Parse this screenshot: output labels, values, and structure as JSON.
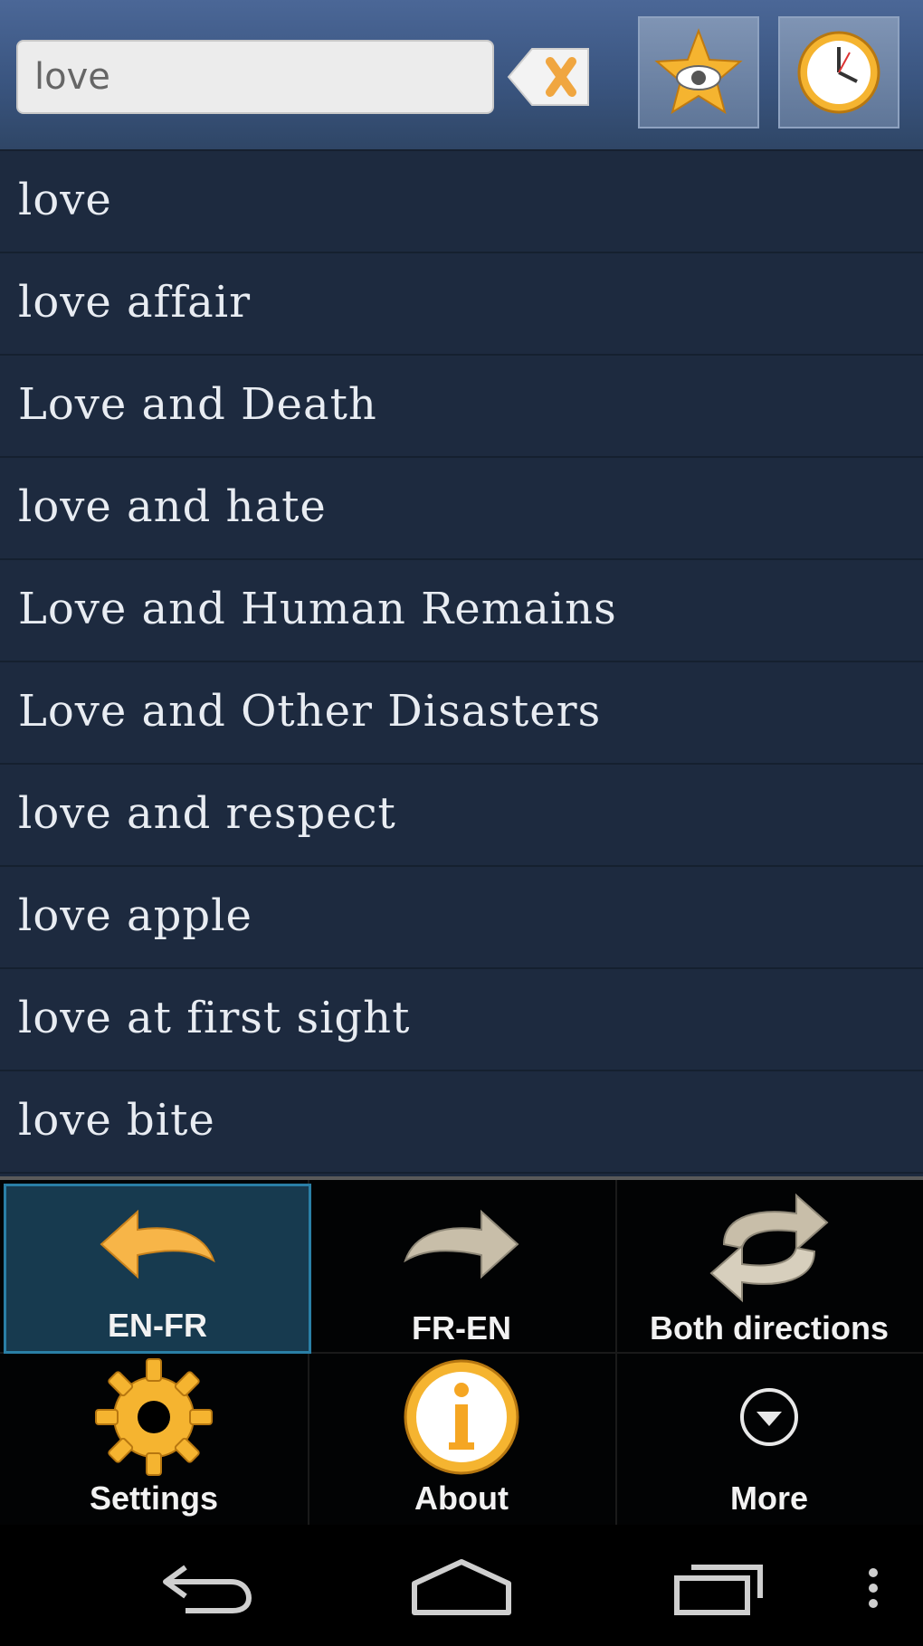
{
  "search": {
    "value": "love",
    "placeholder": ""
  },
  "toolbar": {
    "clear_icon": "clear-icon",
    "favorites_icon": "star-eye-icon",
    "history_icon": "clock-icon"
  },
  "results": [
    "love",
    "love affair",
    "Love and Death",
    "love and hate",
    "Love and Human Remains",
    "Love and Other Disasters",
    "love and respect",
    "love apple",
    "love at first sight",
    "love bite"
  ],
  "menu": {
    "items": [
      {
        "label": "EN-FR",
        "icon": "arrow-left-icon",
        "selected": true
      },
      {
        "label": "FR-EN",
        "icon": "arrow-right-icon",
        "selected": false
      },
      {
        "label": "Both directions",
        "icon": "swap-arrows-icon",
        "selected": false
      },
      {
        "label": "Settings",
        "icon": "gear-icon",
        "selected": false
      },
      {
        "label": "About",
        "icon": "info-icon",
        "selected": false
      },
      {
        "label": "More",
        "icon": "chevron-down-icon",
        "selected": false
      }
    ]
  },
  "navbar": {
    "back_icon": "back-icon",
    "home_icon": "home-icon",
    "recents_icon": "recents-icon",
    "overflow_icon": "overflow-icon"
  },
  "colors": {
    "accent": "#f5a623",
    "list_bg": "#1d2a3f",
    "selected_bg": "#173a4f"
  }
}
